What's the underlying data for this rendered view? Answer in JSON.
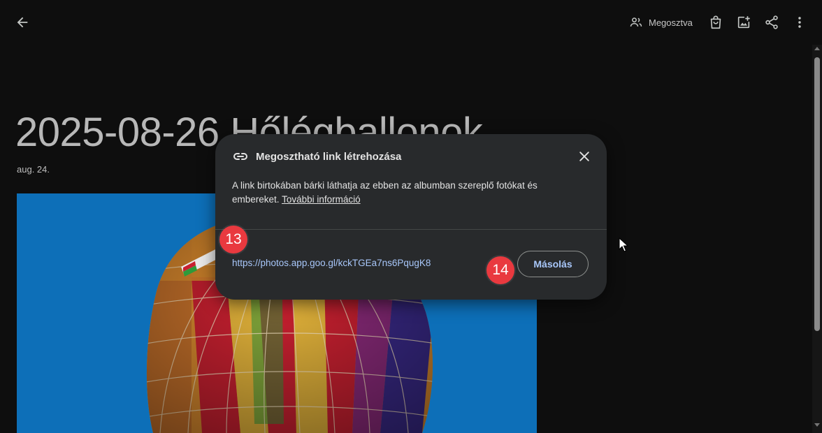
{
  "topbar": {
    "back_icon": "arrow-back-icon",
    "shared_label": "Megosztva",
    "shared_icon": "people-icon",
    "actions": [
      "shopping-bag-icon",
      "add-photo-icon",
      "share-icon",
      "more-vert-icon"
    ]
  },
  "album": {
    "title": "2025-08-26 Hőlégballonok",
    "date": "aug. 24."
  },
  "dialog": {
    "title": "Megosztható link létrehozása",
    "title_icon": "link-icon",
    "description": "A link birtokában bárki láthatja az ebben az albumban szereplő fotókat és embereket.",
    "more_info_link": "További információ",
    "share_url": "https://photos.app.goo.gl/kckTGEa7ns6PqugK8",
    "copy_button": "Másolás",
    "close_icon": "close-icon"
  },
  "annotations": [
    "13",
    "14"
  ],
  "colors": {
    "background": "#0e0e0e",
    "dialog": "#282a2c",
    "accent": "#a8c7fa",
    "badge": "#e9393f",
    "sky": "#0d6fb8"
  }
}
